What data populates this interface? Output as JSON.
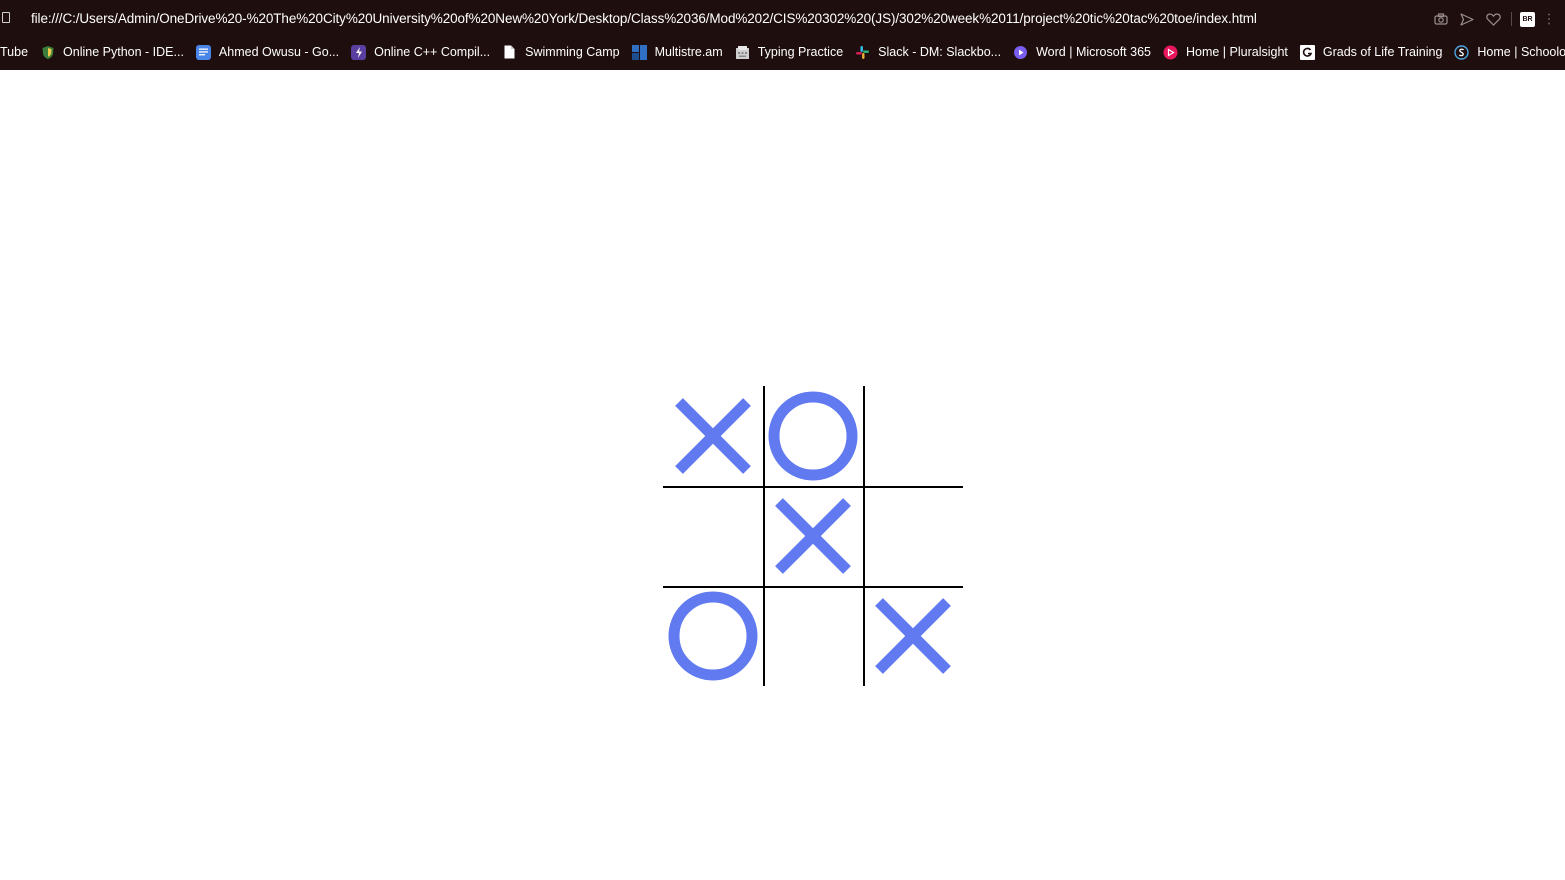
{
  "browser": {
    "url": "file:///C:/Users/Admin/OneDrive%20-%20The%20City%20University%20of%20New%20York/Desktop/Class%2036/Mod%202/CIS%20302%20(JS)/302%20week%2011/project%20tic%20tac%20toe/index.html",
    "extension_badge": "BR",
    "bookmarks": [
      {
        "label": "Tube",
        "icon": "youtube-icon",
        "color": ""
      },
      {
        "label": "Online Python - IDE...",
        "icon": "python-ide-icon",
        "color": "#3b7d3b"
      },
      {
        "label": "Ahmed Owusu - Go...",
        "icon": "google-docs-icon",
        "color": "#4a86e8"
      },
      {
        "label": "Online C++ Compil...",
        "icon": "compiler-icon",
        "color": "#5b3fa0"
      },
      {
        "label": "Swimming Camp",
        "icon": "document-icon",
        "color": "#ffffff"
      },
      {
        "label": "Multistre.am",
        "icon": "multistream-icon",
        "color": "#2f6fc4"
      },
      {
        "label": "Typing Practice",
        "icon": "typing-icon",
        "color": "#cfcfcf"
      },
      {
        "label": "Slack - DM: Slackbo...",
        "icon": "slack-icon",
        "color": "#e01e5a"
      },
      {
        "label": "Word | Microsoft 365",
        "icon": "microsoft-365-icon",
        "color": "#7a5cf0"
      },
      {
        "label": "Home | Pluralsight",
        "icon": "pluralsight-icon",
        "color": "#e8175d"
      },
      {
        "label": "Grads of Life Training",
        "icon": "grads-of-life-icon",
        "color": "#ffffff"
      },
      {
        "label": "Home | Schoology",
        "icon": "schoology-icon",
        "color": "#4aa3df"
      }
    ]
  },
  "game": {
    "mark_color": "#617af0",
    "board": [
      "X",
      "O",
      "",
      "",
      "X",
      "",
      "O",
      "",
      "X"
    ]
  }
}
